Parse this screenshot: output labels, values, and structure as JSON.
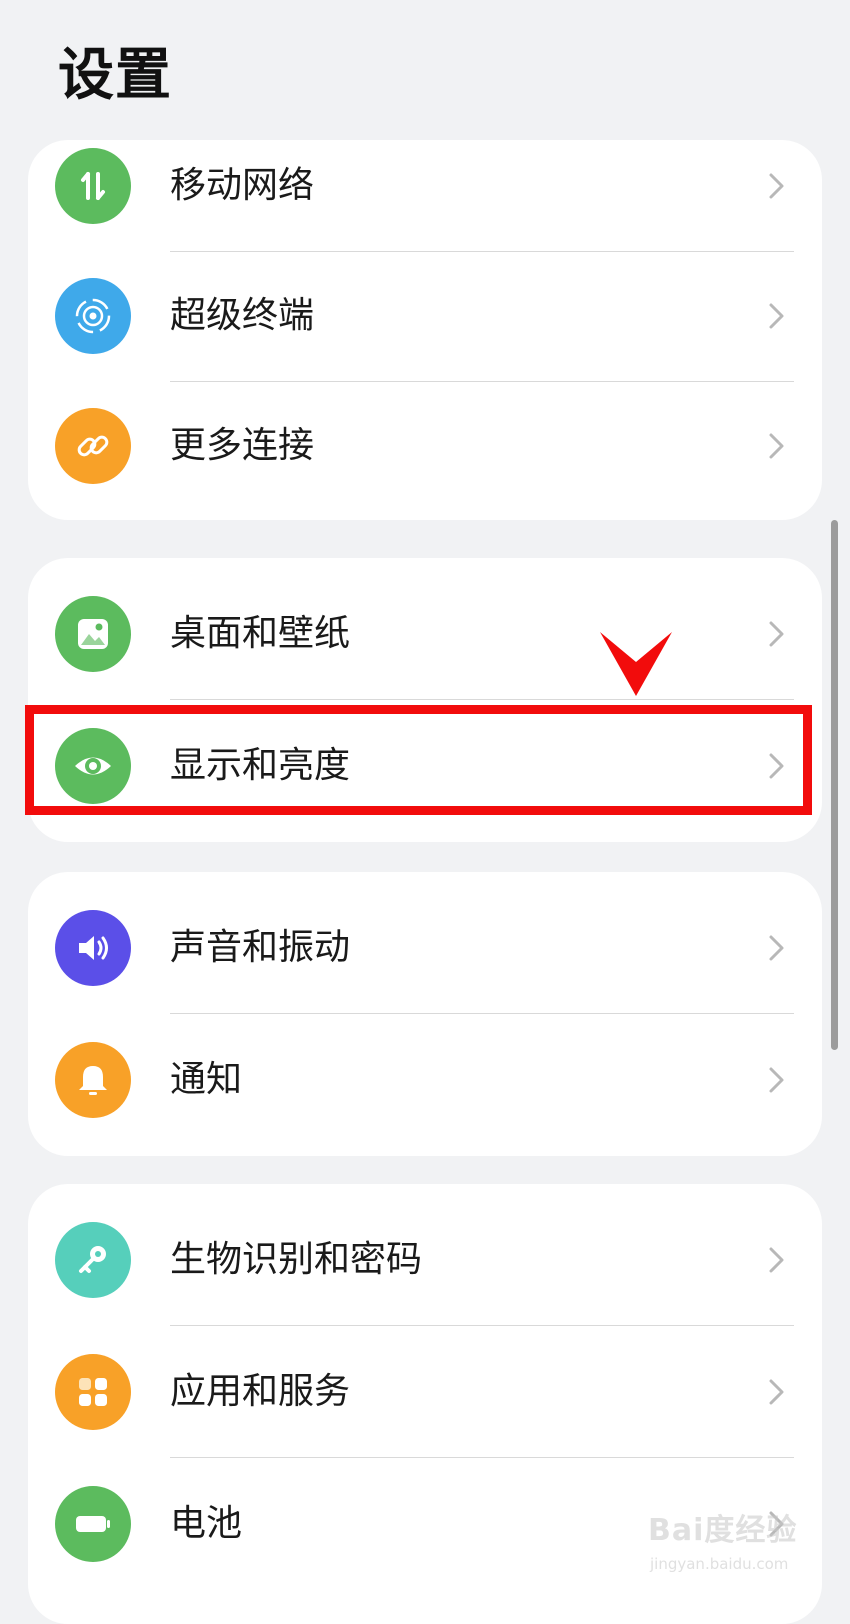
{
  "header": {
    "title": "设置"
  },
  "groups": [
    {
      "items": [
        {
          "label": "移动网络",
          "icon": "mobile-data-icon",
          "color": "#5cbb5e"
        },
        {
          "label": "超级终端",
          "icon": "super-device-icon",
          "color": "#3fa9ea"
        },
        {
          "label": "更多连接",
          "icon": "link-icon",
          "color": "#f8a128"
        }
      ]
    },
    {
      "items": [
        {
          "label": "桌面和壁纸",
          "icon": "wallpaper-icon",
          "color": "#5cbb5e"
        },
        {
          "label": "显示和亮度",
          "icon": "eye-icon",
          "color": "#5cbb5e",
          "highlighted": true
        }
      ]
    },
    {
      "items": [
        {
          "label": "声音和振动",
          "icon": "speaker-icon",
          "color": "#5b4fe8"
        },
        {
          "label": "通知",
          "icon": "bell-icon",
          "color": "#f8a128"
        }
      ]
    },
    {
      "items": [
        {
          "label": "生物识别和密码",
          "icon": "key-icon",
          "color": "#56cfbb"
        },
        {
          "label": "应用和服务",
          "icon": "apps-grid-icon",
          "color": "#f8a128"
        },
        {
          "label": "电池",
          "icon": "battery-icon",
          "color": "#5cbb5e"
        }
      ]
    }
  ],
  "annotation": {
    "highlight_color": "#f20c0c"
  },
  "watermark": {
    "brand": "Bai度经验",
    "url": "jingyan.baidu.com"
  }
}
